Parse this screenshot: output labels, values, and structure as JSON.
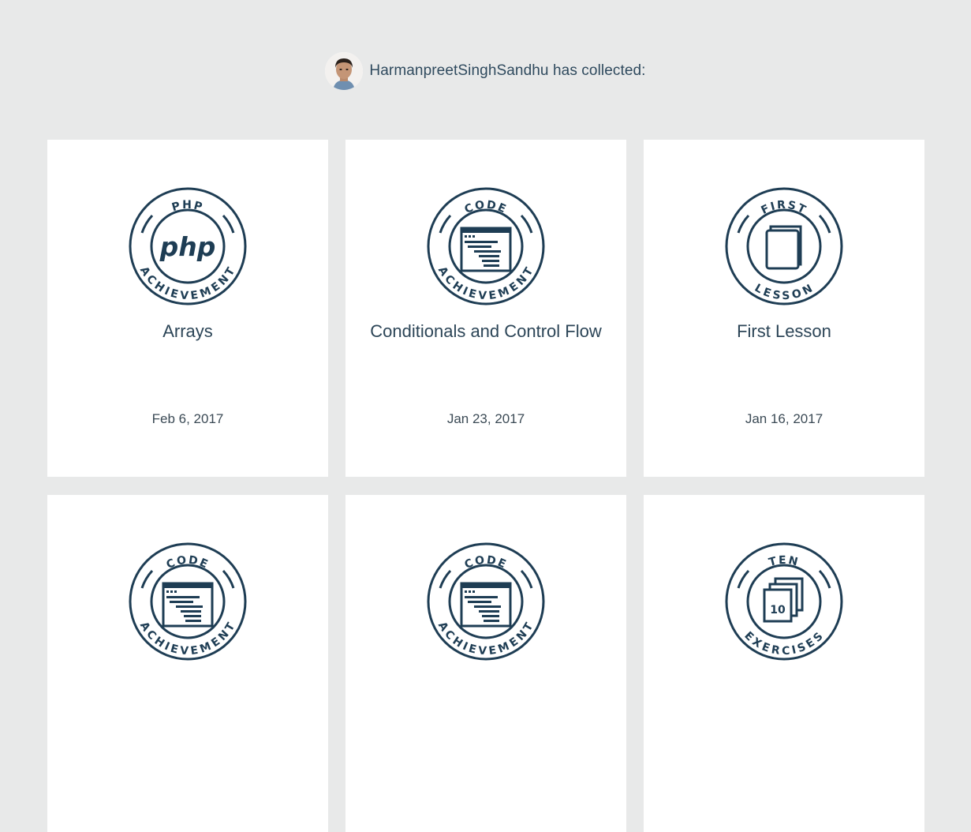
{
  "header": {
    "username": "HarmanpreetSinghSandhu",
    "collected_text": "has collected:"
  },
  "colors": {
    "background": "#e8e9e9",
    "card": "#ffffff",
    "badge_navy": "#1e3d54"
  },
  "achievements": [
    {
      "title": "Arrays",
      "date": "Feb 6, 2017",
      "badge_top": "PHP",
      "badge_bottom": "ACHIEVEMENT",
      "badge_center": "php",
      "icon": "php-logo-icon"
    },
    {
      "title": "Conditionals and Control Flow",
      "date": "Jan 23, 2017",
      "badge_top": "CODE",
      "badge_bottom": "ACHIEVEMENT",
      "icon": "code-window-icon"
    },
    {
      "title": "First Lesson",
      "date": "Jan 16, 2017",
      "badge_top": "FIRST",
      "badge_bottom": "LESSON",
      "icon": "book-icon"
    },
    {
      "title": "",
      "date": "",
      "badge_top": "CODE",
      "badge_bottom": "ACHIEVEMENT",
      "icon": "code-window-icon"
    },
    {
      "title": "",
      "date": "",
      "badge_top": "CODE",
      "badge_bottom": "ACHIEVEMENT",
      "icon": "code-window-icon"
    },
    {
      "title": "",
      "date": "",
      "badge_top": "TEN",
      "badge_bottom": "EXERCISES",
      "badge_center": "10",
      "icon": "stacked-pages-icon"
    }
  ]
}
